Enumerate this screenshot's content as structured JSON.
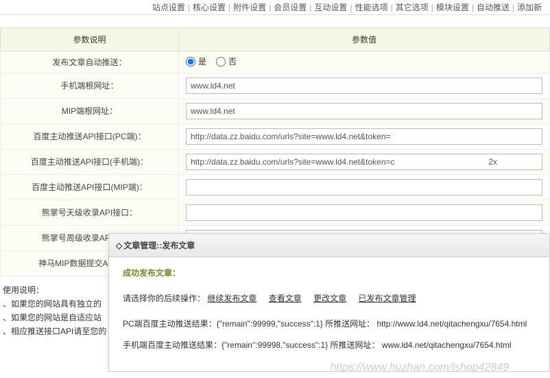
{
  "topnav": {
    "items": [
      "站点设置",
      "核心设置",
      "附件设置",
      "会员设置",
      "互动设置",
      "性能选项",
      "其它选项",
      "模块设置",
      "自动推送",
      "添加新"
    ]
  },
  "table": {
    "headers": {
      "param": "参数说明",
      "value": "参数值"
    },
    "radio": {
      "yes": "是",
      "no": "否"
    },
    "rows": [
      {
        "label": "发布文章自动推送：",
        "type": "radio"
      },
      {
        "label": "手机端根网址：",
        "type": "text",
        "value": "www.ld4.net"
      },
      {
        "label": "MIP端根网址：",
        "type": "text",
        "value": "www.ld4.net"
      },
      {
        "label": "百度主动推送API接口(PC端)：",
        "type": "text",
        "value": "http://data.zz.baidu.com/urls?site=www.ld4.net&token="
      },
      {
        "label": "百度主动推送API接口(手机端)：",
        "type": "text",
        "value": "http://data.zz.baidu.com/urls?site=www.ld4.net&token=c                                         2x"
      },
      {
        "label": "百度主动推送API接口(MIP端)：",
        "type": "text",
        "value": ""
      },
      {
        "label": "熊掌号天级收录API接口：",
        "type": "text",
        "value": ""
      },
      {
        "label": "熊掌号周级收录API接口：",
        "type": "text",
        "value": ""
      },
      {
        "label": "神马MIP数据提交API接口：",
        "type": "text",
        "value": ""
      }
    ]
  },
  "usage": {
    "title": "使用说明：",
    "lines": [
      "、如果您的网站具有独立的",
      "、如果您的网站是自适应站",
      "、相应推送接口API请至您的"
    ]
  },
  "overlay": {
    "header": "文章管理::发布文章",
    "success": "成功发布文章：",
    "prompt": "请选择你的后续操作：",
    "actions": [
      "继续发布文章",
      "查看文章",
      "更改文章",
      "已发布文章管理"
    ],
    "result_pc": "PC端百度主动推送结果：{\"remain\":99999,\"success\":1} 所推送网址： http://www.ld4.net/qitachengxu/7654.html",
    "result_mobile": "手机端百度主动推送结果：{\"remain\":99998,\"success\":1} 所推送网址： www.ld4.net/qitachengxu/7654.html"
  },
  "watermark": "https://www.huzhan.com/ishop42849"
}
